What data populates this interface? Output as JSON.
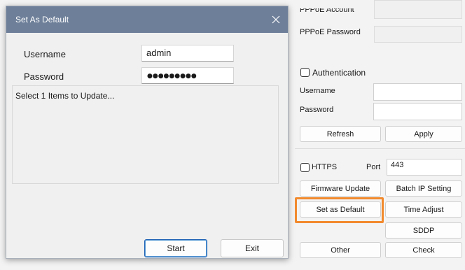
{
  "background": {
    "pppoe_account_label": "PPPoE Account",
    "pppoe_password_label": "PPPoE Password",
    "authentication_label": "Authentication",
    "username_label": "Username",
    "password_label": "Password",
    "refresh_label": "Refresh",
    "apply_label": "Apply",
    "https_label": "HTTPS",
    "port_label": "Port",
    "port_value": "443",
    "firmware_update_label": "Firmware Update",
    "batch_ip_label": "Batch IP Setting",
    "set_default_label": "Set as Default",
    "time_adjust_label": "Time Adjust",
    "sddp_label": "SDDP",
    "other_label": "Other",
    "check_label": "Check"
  },
  "dialog": {
    "title": "Set As Default",
    "username_label": "Username",
    "username_value": "admin",
    "password_label": "Password",
    "password_mask": "●●●●●●●●●",
    "message": "Select 1 Items to Update...",
    "start_label": "Start",
    "exit_label": "Exit"
  },
  "colors": {
    "titlebar": "#6d7f99",
    "highlight": "#f28a2e"
  }
}
